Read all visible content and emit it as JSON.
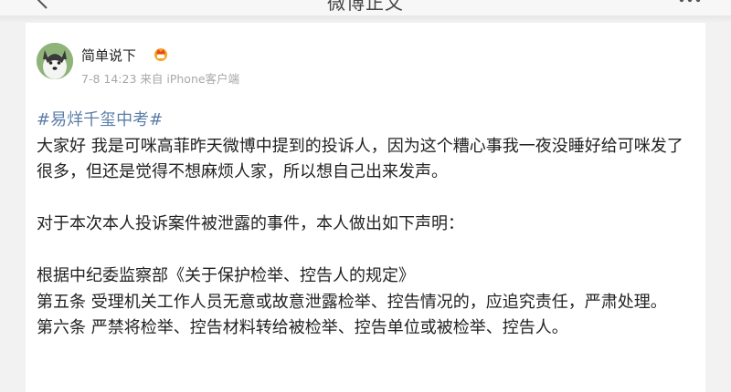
{
  "header": {
    "title": "微博正文",
    "back_icon": "chevron-left-icon",
    "more_icon": "ellipsis-icon"
  },
  "post": {
    "author": "简单说下",
    "badge_icon": "crown-badge-icon",
    "meta": "7-8 14:23 来自 iPhone客户端",
    "topic": "#易烊千玺中考#",
    "paragraphs": [
      "大家好 我是可咪高菲昨天微博中提到的投诉人，因为这个糟心事我一夜没睡好给可咪发了很多，但还是觉得不想麻烦人家，所以想自己出来发声。",
      "",
      "对于本次本人投诉案件被泄露的事件，本人做出如下声明：",
      "",
      "根据中纪委监察部《关于保护检举、控告人的规定》",
      "第五条 受理机关工作人员无意或故意泄露检举、控告情况的，应追究责任，严肃处理。",
      "第六条 严禁将检举、控告材料转给被检举、控告单位或被检举、控告人。"
    ]
  },
  "colors": {
    "link": "#5b7ea8",
    "meta": "#a8a8a8",
    "background": "#f2f2f2"
  }
}
